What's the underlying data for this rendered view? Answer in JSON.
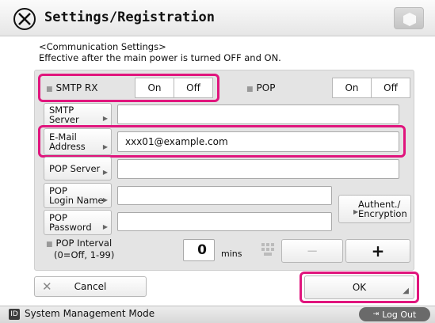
{
  "header": {
    "title": "Settings/Registration",
    "info_line1": "<Communication Settings>",
    "info_line2": "Effective after the main power is turned OFF and ON."
  },
  "smtp_rx": {
    "label": "SMTP RX",
    "on": "On",
    "off": "Off"
  },
  "pop": {
    "label": "POP",
    "on": "On",
    "off": "Off"
  },
  "fields": {
    "smtp_server": {
      "label": "SMTP Server",
      "value": ""
    },
    "email_line1": "E-Mail",
    "email_line2": "Address",
    "email_value": "xxx01@example.com",
    "pop_server": {
      "label": "POP Server",
      "value": ""
    },
    "pop_login_line1": "POP",
    "pop_login_line2": "Login Name",
    "pop_login_value": "",
    "pop_password_line1": "POP",
    "pop_password_line2": "Password",
    "pop_password_value": ""
  },
  "authent": {
    "line1": "Authent./",
    "line2": "Encryption"
  },
  "pop_interval": {
    "label_line1": "POP Interval",
    "label_line2": "(0=Off, 1-99)",
    "value": "0",
    "unit": "mins",
    "minus": "−",
    "plus": "+"
  },
  "buttons": {
    "cancel": "Cancel",
    "ok": "OK"
  },
  "statusbar": {
    "mode": "System Management Mode",
    "mode_icon": "ID",
    "logout": "Log Out"
  },
  "colors": {
    "highlight": "#e0157d"
  }
}
